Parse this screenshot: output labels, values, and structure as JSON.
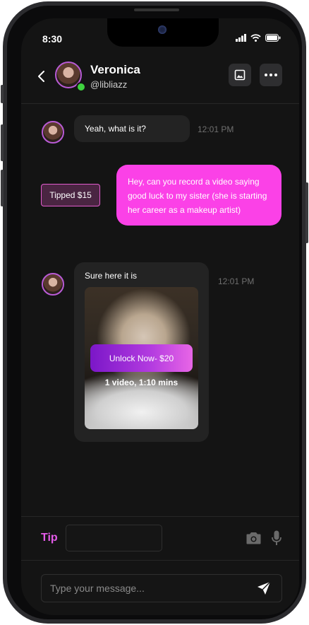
{
  "status": {
    "time": "8:30"
  },
  "header": {
    "name": "Veronica",
    "handle": "@libliazz"
  },
  "messages": [
    {
      "from": "them",
      "text": "Yeah, what is it?",
      "time": "12:01 PM"
    },
    {
      "from": "me",
      "text": "Hey, can you record a video saying good luck to my sister (she is starting her career as a makeup artist)"
    },
    {
      "from": "them",
      "text": "Sure here it is",
      "time": "12:01 PM"
    }
  ],
  "tip_badge": "Tipped $15",
  "media": {
    "unlock_label": "Unlock Now-  $20",
    "info": "1 video, 1:10 mins"
  },
  "composer": {
    "tip_label": "Tip",
    "placeholder": "Type your message..."
  },
  "colors": {
    "accent": "#fb41e7",
    "tip_label": "#e45be9",
    "online": "#3fd23f"
  }
}
